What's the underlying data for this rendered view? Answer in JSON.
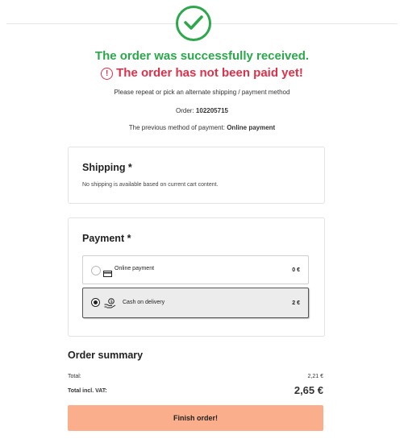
{
  "header": {
    "success_message": "The order was successfully received.",
    "unpaid_message": "The order has not been paid yet!",
    "warning_icon": "!"
  },
  "info": {
    "instruction": "Please repeat or pick an alternate shipping / payment method",
    "order_label": "Order:",
    "order_number": "102205715",
    "prev_method_label": "The previous method of payment:",
    "prev_method_value": "Online payment"
  },
  "shipping": {
    "title": "Shipping *",
    "message": "No shipping is available based on current cart content."
  },
  "payment": {
    "title": "Payment *",
    "options": [
      {
        "label": "Online payment",
        "price": "0 €",
        "selected": false,
        "icon": "credit-card-icon"
      },
      {
        "label": "Cash on delivery",
        "price": "2 €",
        "selected": true,
        "icon": "cash-hand-icon"
      }
    ]
  },
  "summary": {
    "title": "Order summary",
    "total_label": "Total:",
    "total_value": "2,21 €",
    "total_vat_label": "Total incl. VAT:",
    "total_vat_value": "2,65 €"
  },
  "finish_button": "Finish order!",
  "colors": {
    "success": "#2aa84a",
    "error": "#e03049",
    "button": "#fbae8c"
  }
}
